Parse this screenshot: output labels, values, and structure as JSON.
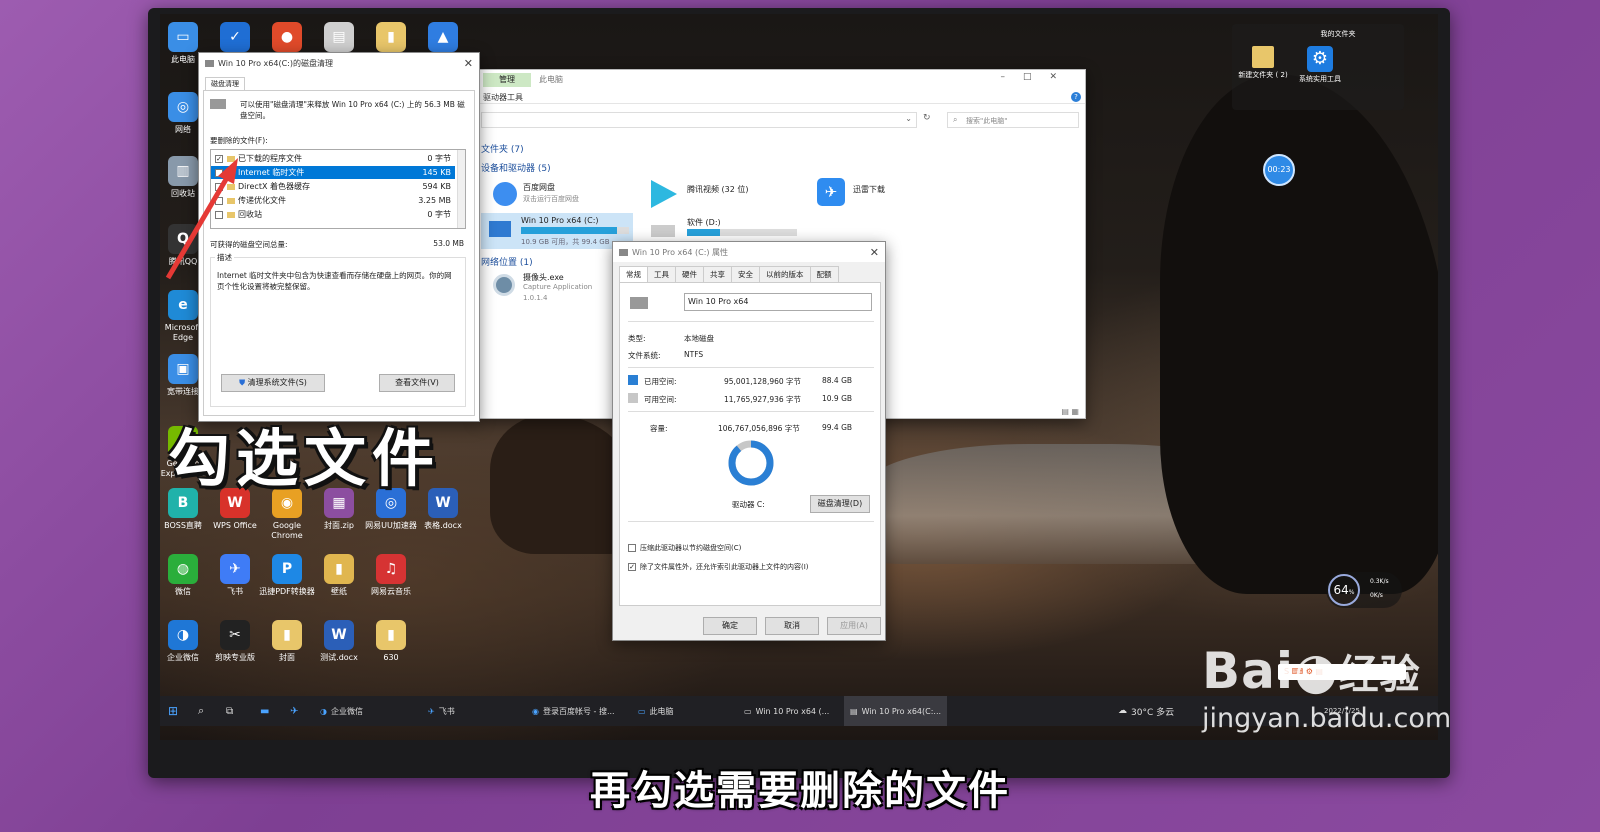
{
  "desktop": {
    "left_icons": [
      {
        "label": "此电脑",
        "color": "#3a8ee6",
        "glyph": "▭"
      },
      {
        "label": "网络",
        "color": "#3a8ee6",
        "glyph": "◎"
      },
      {
        "label": "回收站",
        "color": "#8899aa",
        "glyph": "▥"
      },
      {
        "label": "腾讯QQ",
        "color": "#333",
        "glyph": "Q"
      },
      {
        "label": "Microsoft Edge",
        "color": "#1f8ad6",
        "glyph": "e"
      },
      {
        "label": "宽带连接",
        "color": "#3a8ee6",
        "glyph": "▣"
      },
      {
        "label": "GeForce Experience",
        "color": "#76b900",
        "glyph": "G"
      }
    ],
    "top_icons": [
      {
        "color": "#1f6ed4",
        "glyph": "✓"
      },
      {
        "color": "#e04a2a",
        "glyph": "●"
      },
      {
        "color": "#cfcfcf",
        "glyph": "▤"
      },
      {
        "color": "#e8c66a",
        "glyph": "▮"
      },
      {
        "color": "#2f7de1",
        "glyph": "▲"
      }
    ],
    "grid_icons": [
      {
        "label": "BOSS直聘",
        "color": "#20b2aa",
        "glyph": "B"
      },
      {
        "label": "WPS Office",
        "color": "#d8322a",
        "glyph": "W"
      },
      {
        "label": "Google Chrome",
        "color": "#e8a023",
        "glyph": "◉"
      },
      {
        "label": "封面.zip",
        "color": "#8c4ea0",
        "glyph": "▦"
      },
      {
        "label": "网易UU加速器",
        "color": "#2a6fd6",
        "glyph": "◎"
      },
      {
        "label": "表格.docx",
        "color": "#2b5fb8",
        "glyph": "W"
      },
      {
        "label": "微信",
        "color": "#2aae3b",
        "glyph": "◍"
      },
      {
        "label": "飞书",
        "color": "#3f7cf6",
        "glyph": "✈"
      },
      {
        "label": "迅捷PDF转换器",
        "color": "#1e88e5",
        "glyph": "P"
      },
      {
        "label": "壁纸",
        "color": "#e0b64f",
        "glyph": "▮"
      },
      {
        "label": "网易云音乐",
        "color": "#d63333",
        "glyph": "♫"
      },
      {
        "label": "",
        "color": "transparent",
        "glyph": ""
      },
      {
        "label": "企业微信",
        "color": "#1f77d6",
        "glyph": "◑"
      },
      {
        "label": "剪映专业版",
        "color": "#222",
        "glyph": "✂"
      },
      {
        "label": "封面",
        "color": "#e8c66a",
        "glyph": "▮"
      },
      {
        "label": "测试.docx",
        "color": "#2b5fb8",
        "glyph": "W"
      },
      {
        "label": "630",
        "color": "#e8c66a",
        "glyph": "▮"
      }
    ],
    "right_panel": {
      "title": "我的文件夹",
      "items": [
        {
          "label": "新建文件夹 ( 2)"
        },
        {
          "label": "系统实用工具"
        }
      ]
    },
    "timer": "00:23",
    "network_widget": {
      "percent": "64",
      "unit": "%",
      "up": "0.3K/s",
      "down": "0K/s"
    }
  },
  "cleanup_dialog": {
    "title": "Win 10 Pro x64(C:)的磁盘清理",
    "tab": "磁盘清理",
    "intro": "可以使用\"磁盘清理\"来释放 Win 10 Pro x64 (C:) 上的 56.3 MB 磁盘空间。",
    "files_label": "要删除的文件(F):",
    "files": [
      {
        "name": "已下载的程序文件",
        "size": "0 字节",
        "checked": true
      },
      {
        "name": "Internet 临时文件",
        "size": "145 KB",
        "checked": true,
        "selected": true
      },
      {
        "name": "DirectX 着色器缓存",
        "size": "594 KB",
        "checked": false
      },
      {
        "name": "传递优化文件",
        "size": "3.25 MB",
        "checked": false
      },
      {
        "name": "回收站",
        "size": "0 字节",
        "checked": false
      }
    ],
    "total_label": "可获得的磁盘空间总量:",
    "total_value": "53.0 MB",
    "desc_label": "描述",
    "desc_text": "Internet 临时文件夹中包含为快速查看而存储在硬盘上的网页。你的网页个性化设置将被完整保留。",
    "btn_clean_system": "清理系统文件(S)",
    "btn_view_files": "查看文件(V)"
  },
  "explorer": {
    "ribbon_tab_manage": "管理",
    "ribbon_tab_pc": "此电脑",
    "ribbon_sub": "驱动器工具",
    "search_placeholder": "搜索\"此电脑\"",
    "section_folders": "文件夹 (7)",
    "section_devices": "设备和驱动器 (5)",
    "section_network": "网络位置 (1)",
    "devices": [
      {
        "name": "百度网盘",
        "sub": "双击运行百度网盘",
        "color": "#3d8ef0"
      },
      {
        "name": "腾讯视频 (32 位)",
        "sub": "",
        "color": "#1fc1d9"
      },
      {
        "name": "迅雷下载",
        "sub": "",
        "color": "#2f8cf0"
      }
    ],
    "drive_c": {
      "name": "Win 10 Pro x64 (C:)",
      "sub": "10.9 GB 可用，共 99.4 GB",
      "fill": 0.89
    },
    "drive_d": {
      "name": "软件 (D:)",
      "fill": 0.3
    },
    "network_item": {
      "name": "摄像头.exe",
      "sub": "Capture Application",
      "ver": "1.0.1.4"
    }
  },
  "props_dialog": {
    "title": "Win 10 Pro x64 (C:) 属性",
    "tabs": [
      "常规",
      "工具",
      "硬件",
      "共享",
      "安全",
      "以前的版本",
      "配额"
    ],
    "name_value": "Win 10 Pro x64",
    "type_label": "类型:",
    "type_value": "本地磁盘",
    "fs_label": "文件系统:",
    "fs_value": "NTFS",
    "used_label": "已用空间:",
    "used_bytes": "95,001,128,960 字节",
    "used_gb": "88.4 GB",
    "free_label": "可用空间:",
    "free_bytes": "11,765,927,936 字节",
    "free_gb": "10.9 GB",
    "cap_label": "容量:",
    "cap_bytes": "106,767,056,896 字节",
    "cap_gb": "99.4 GB",
    "used_fraction": 0.889,
    "drive_label": "驱动器 C:",
    "btn_cleanup": "磁盘清理(D)",
    "compress": "压缩此驱动器以节约磁盘空间(C)",
    "index": "除了文件属性外，还允许索引此驱动器上文件的内容(I)",
    "btn_ok": "确定",
    "btn_cancel": "取消",
    "btn_apply": "应用(A)",
    "colors": {
      "used": "#2a7fd4",
      "free": "#c7c7c7"
    }
  },
  "taskbar": {
    "items": [
      "企业微信",
      "飞书",
      "登录百度帐号 - 搜...",
      "此电脑",
      "Win 10 Pro x64 (...",
      "Win 10 Pro x64(C:..."
    ],
    "weather": "30°C 多云",
    "date": "2022/7/25"
  },
  "overlay": {
    "big_label": "勾选文件",
    "caption": "再勾选需要删除的文件",
    "watermark_brand": "Bai",
    "watermark_cn": "经验",
    "watermark_url": "jingyan.baidu.com"
  }
}
